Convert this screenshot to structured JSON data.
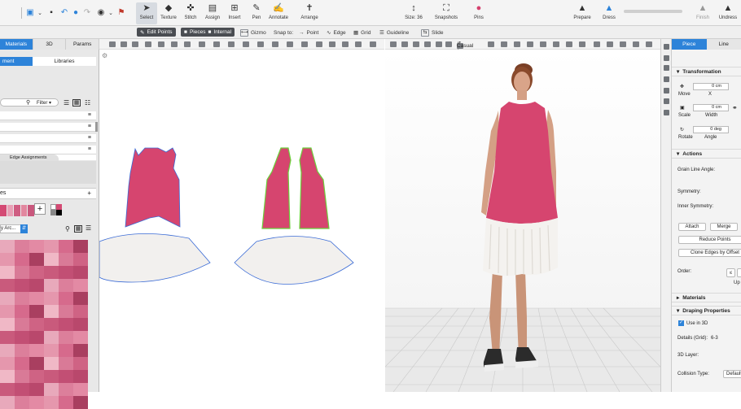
{
  "toolbar": {
    "select": "Select",
    "texture": "Texture",
    "stitch": "Stitch",
    "assign": "Assign",
    "insert": "Insert",
    "pen": "Pen",
    "annotate": "Annotate",
    "arrange": "Arrange",
    "size": "Size: 36",
    "snapshots": "Snapshots",
    "pins": "Pins",
    "prepare": "Prepare",
    "dress": "Dress",
    "finish": "Finish",
    "undress": "Undress"
  },
  "subbar": {
    "edit_points": "Edit Points",
    "pieces": "Pieces",
    "internal": "Internal",
    "gizmo": "Gizmo",
    "snap_to": "Snap to:",
    "point": "Point",
    "edge": "Edge",
    "grid": "Grid",
    "guideline": "Guideline",
    "slide": "Slide"
  },
  "left": {
    "tabs": [
      "Materials",
      "3D",
      "Params"
    ],
    "subtabs": [
      "ment",
      "Libraries"
    ],
    "filter": "Filter",
    "edge_assignments": "Edge Assignments",
    "section_es": "es",
    "plus": "+",
    "dropdown": "y Arc...",
    "colors": {
      "accent": "#2d83d9",
      "pink": "#d5406d"
    }
  },
  "view3d": {
    "camera": "Casual 1"
  },
  "right": {
    "tabs": [
      "Piece",
      "Line"
    ],
    "transformation": "Transformation",
    "move_label": "Move",
    "move_x": "X",
    "move_value": "0",
    "move_unit": "cm",
    "scale_label": "Scale",
    "scale_sub": "Width",
    "scale_value": "0",
    "scale_unit": "cm",
    "rotate_label": "Rotate",
    "rotate_sub": "Angle",
    "rotate_value": "0",
    "rotate_unit": "deg",
    "actions": "Actions",
    "grain": "Grain Line Angle:",
    "symmetry": "Symmetry:",
    "inner_symmetry": "Inner Symmetry:",
    "attach": "Attach",
    "merge": "Merge",
    "reduce": "Reduce Points",
    "clone": "Clone Edges by Offset",
    "order": "Order:",
    "up": "Up",
    "materials": "Materials",
    "draping": "Draping Properties",
    "use3d": "Use in 3D",
    "details": "Details (Grid):",
    "details_value": "6-3",
    "layer": "3D Layer:",
    "collision": "Collision Type:",
    "collision_value": "Default"
  }
}
